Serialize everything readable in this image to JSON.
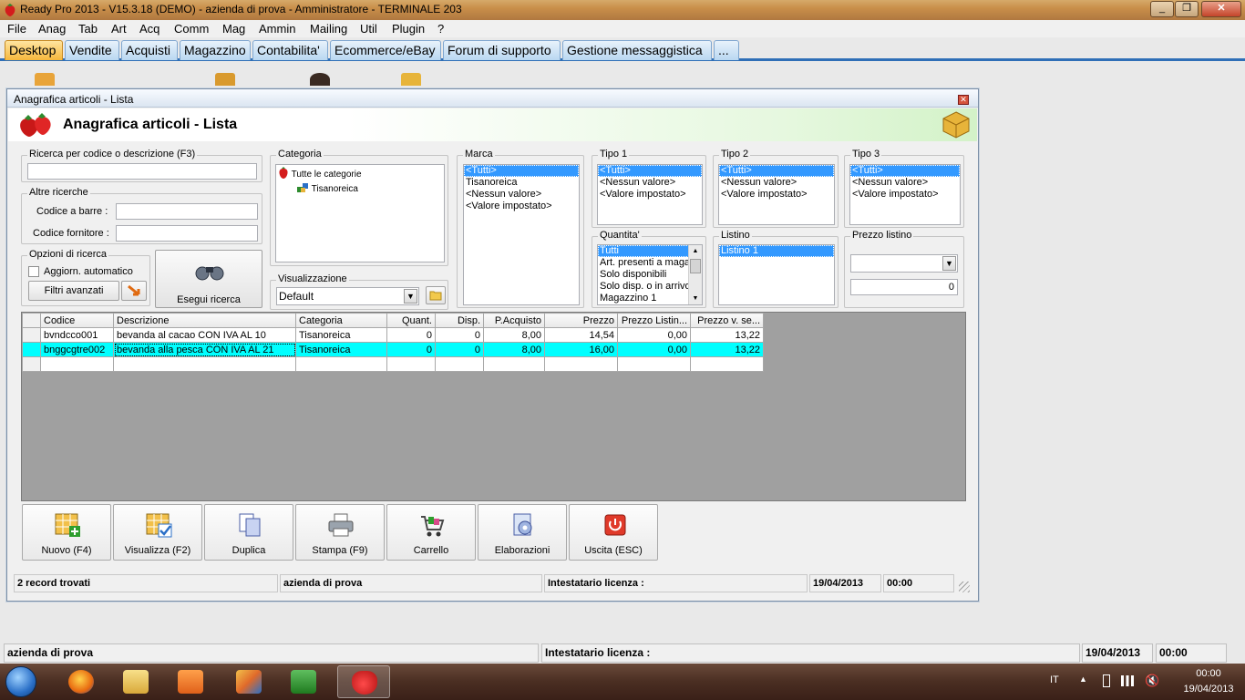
{
  "titlebar": {
    "title": "Ready Pro 2013 - V15.3.18 (DEMO)  - azienda di prova - Amministratore - TERMINALE 203"
  },
  "menu": [
    "File",
    "Anag",
    "Tab",
    "Art",
    "Acq",
    "Comm",
    "Mag",
    "Ammin",
    "Mailing",
    "Util",
    "Plugin",
    "?"
  ],
  "tabs": [
    "Desktop",
    "Vendite",
    "Acquisti",
    "Magazzino",
    "Contabilita'",
    "Ecommerce/eBay",
    "Forum di supporto",
    "Gestione messaggistica",
    "..."
  ],
  "window": {
    "title": "Anagrafica articoli  - Lista",
    "header": "Anagrafica articoli  - Lista",
    "search": {
      "label": "Ricerca per codice o descrizione (F3)",
      "value": ""
    },
    "altre": {
      "label": "Altre ricerche",
      "barcode_label": "Codice a barre :",
      "barcode_value": "",
      "fornitore_label": "Codice fornitore :",
      "fornitore_value": ""
    },
    "opzioni": {
      "label": "Opzioni di ricerca",
      "auto_label": "Aggiorn. automatico",
      "filtri": "Filtri avanzati"
    },
    "esegui": "Esegui ricerca",
    "categoria": {
      "label": "Categoria",
      "root": "Tutte le categorie",
      "child": "Tisanoreica"
    },
    "visualizzazione": {
      "label": "Visualizzazione",
      "value": "Default"
    },
    "marca": {
      "label": "Marca",
      "items": [
        "<Tutti>",
        "Tisanoreica",
        "<Nessun valore>",
        "<Valore impostato>"
      ]
    },
    "tipo1": {
      "label": "Tipo 1",
      "items": [
        "<Tutti>",
        "<Nessun valore>",
        "<Valore impostato>"
      ]
    },
    "tipo2": {
      "label": "Tipo 2",
      "items": [
        "<Tutti>",
        "<Nessun valore>",
        "<Valore impostato>"
      ]
    },
    "tipo3": {
      "label": "Tipo 3",
      "items": [
        "<Tutti>",
        "<Nessun valore>",
        "<Valore impostato>"
      ]
    },
    "quantita": {
      "label": "Quantita'",
      "items": [
        "Tutti",
        "Art. presenti a magazzino",
        "Solo disponibili",
        "Solo disp. o in arrivo",
        "Magazzino 1"
      ]
    },
    "listino": {
      "label": "Listino",
      "items": [
        "Listino 1"
      ]
    },
    "prezzo": {
      "label": "Prezzo listino",
      "select": "",
      "value": "0"
    },
    "grid": {
      "columns": [
        "Codice",
        "Descrizione",
        "Categoria",
        "Quant.",
        "Disp.",
        "P.Acquisto",
        "Prezzo",
        "Prezzo Listin...",
        "Prezzo v. se..."
      ],
      "rows": [
        [
          "bvndcco001",
          "bevanda al cacao CON IVA AL 10",
          "Tisanoreica",
          "0",
          "0",
          "8,00",
          "14,54",
          "0,00",
          "13,22"
        ],
        [
          "bnggcgtre002",
          "bevanda alla pesca CON IVA AL 21",
          "Tisanoreica",
          "0",
          "0",
          "8,00",
          "16,00",
          "0,00",
          "13,22"
        ]
      ]
    },
    "toolbar": [
      "Nuovo (F4)",
      "Visualizza (F2)",
      "Duplica",
      "Stampa (F9)",
      "Carrello",
      "Elaborazioni",
      "Uscita (ESC)"
    ],
    "status": {
      "records": "2 record trovati",
      "azienda": "azienda di prova",
      "licenza": "Intestatario licenza :",
      "date": "19/04/2013",
      "time": "00:00"
    }
  },
  "mainstatus": {
    "azienda": "azienda di prova",
    "licenza": "Intestatario licenza :",
    "date": "19/04/2013",
    "time": "00:00"
  },
  "tray": {
    "lang": "IT",
    "time": "00:00",
    "date": "19/04/2013"
  }
}
